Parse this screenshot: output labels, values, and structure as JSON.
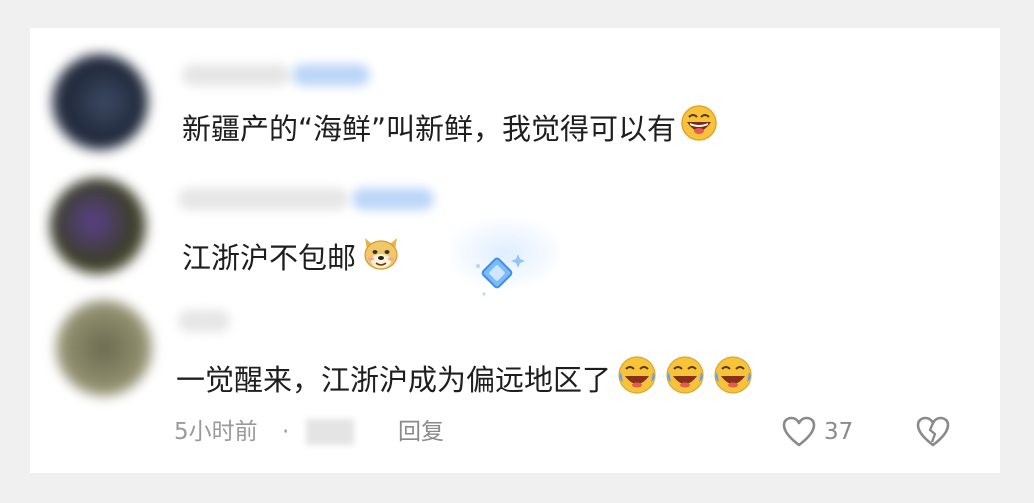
{
  "comments": [
    {
      "text": "新疆产的“海鲜”叫新鲜，我觉得可以有",
      "emoji": "grinning-face-emoji"
    },
    {
      "text": "江浙沪不包邮",
      "emoji": "doge-emoji",
      "decoration": "sparkle-badge-icon"
    },
    {
      "text": "一觉醒来，江浙沪成为偏远地区了",
      "emoji": "laughing-crying-emoji"
    }
  ],
  "meta": {
    "time": "5小时前",
    "separator": "·",
    "reply_label": "回复",
    "like_count": "37"
  },
  "icons": {
    "like": "heart-outline-icon",
    "dislike": "broken-heart-icon"
  },
  "colors": {
    "text": "#1e1e1e",
    "meta": "#9a9a9a",
    "emoji_yellow": "#f6c33b",
    "badge_blue": "#5aa7f5"
  }
}
